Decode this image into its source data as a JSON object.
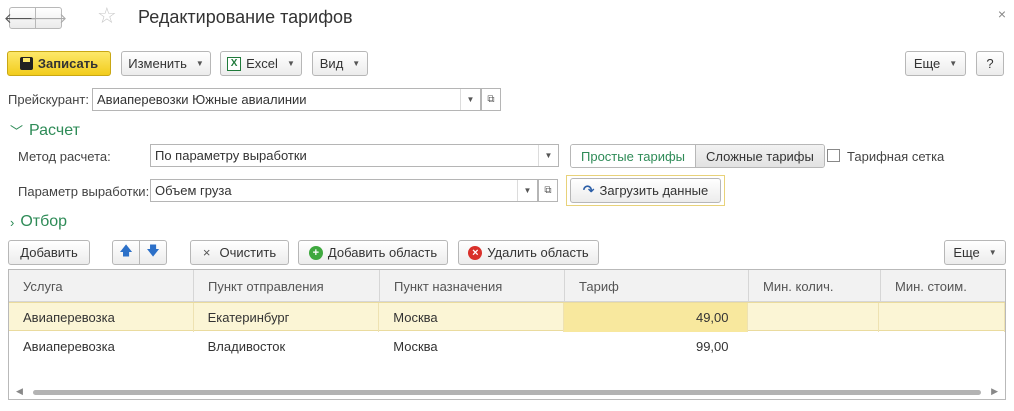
{
  "title": "Редактирование тарифов",
  "nav": {
    "back": "🡐",
    "forward": "🡒",
    "favorite": "☆",
    "close": "×"
  },
  "toolbar": {
    "save": "Записать",
    "edit": "Изменить",
    "excel": "Excel",
    "view": "Вид",
    "more": "Еще",
    "help": "?"
  },
  "pricelist": {
    "label": "Прейскурант:",
    "value": "Авиаперевозки Южные авиалинии"
  },
  "calc_section": "Расчет",
  "method": {
    "label": "Метод расчета:",
    "value": "По параметру выработки"
  },
  "tumbler": {
    "simple": "Простые тарифы",
    "complex": "Сложные тарифы"
  },
  "tariff_grid": {
    "label": "Тарифная сетка",
    "checked": false
  },
  "param": {
    "label": "Параметр выработки:",
    "value": "Объем груза"
  },
  "load_button": "Загрузить данные",
  "filter_section": "Отбор",
  "table_toolbar": {
    "add": "Добавить",
    "up": "🡅",
    "down": "🡇",
    "clear": "Очистить",
    "clear_icon": "×",
    "add_area": "Добавить область",
    "remove_area": "Удалить область",
    "more": "Еще"
  },
  "table": {
    "columns": [
      "Услуга",
      "Пункт отправления",
      "Пункт назначения",
      "Тариф",
      "Мин. колич.",
      "Мин. стоим."
    ],
    "rows": [
      {
        "service": "Авиаперевозка",
        "from": "Екатеринбург",
        "to": "Москва",
        "tariff": "49,00",
        "min_qty": "",
        "min_cost": ""
      },
      {
        "service": "Авиаперевозка",
        "from": "Владивосток",
        "to": "Москва",
        "tariff": "99,00",
        "min_qty": "",
        "min_cost": ""
      }
    ]
  },
  "colors": {
    "accent_green": "#2e8b57",
    "save_yellow": "#f2cc1c",
    "selected_row": "#fbf5d5"
  }
}
